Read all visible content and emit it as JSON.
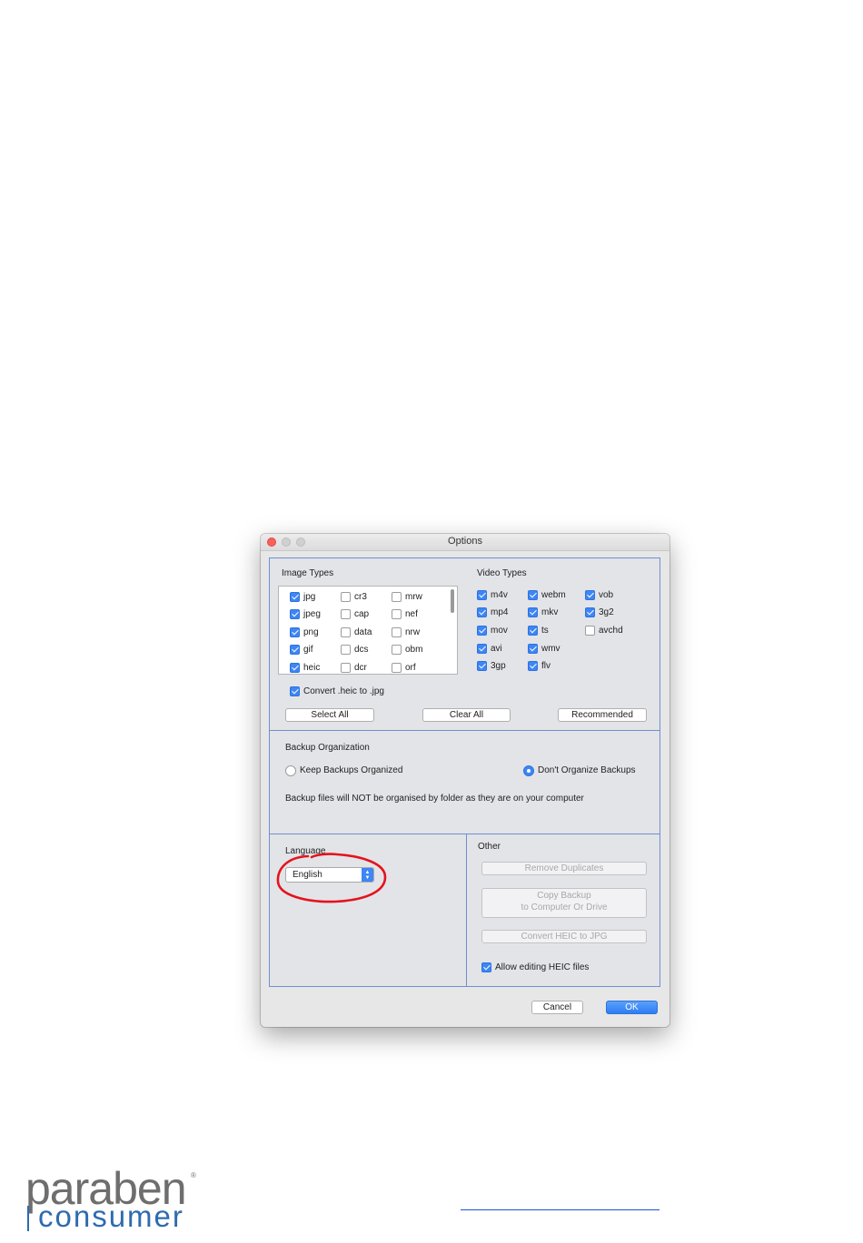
{
  "window": {
    "title": "Options"
  },
  "image_types": {
    "heading": "Image Types",
    "items": [
      {
        "label": "jpg",
        "checked": true
      },
      {
        "label": "jpeg",
        "checked": true
      },
      {
        "label": "png",
        "checked": true
      },
      {
        "label": "gif",
        "checked": true
      },
      {
        "label": "heic",
        "checked": true
      },
      {
        "label": "cr3",
        "checked": false
      },
      {
        "label": "cap",
        "checked": false
      },
      {
        "label": "data",
        "checked": false
      },
      {
        "label": "dcs",
        "checked": false
      },
      {
        "label": "dcr",
        "checked": false
      },
      {
        "label": "mrw",
        "checked": false
      },
      {
        "label": "nef",
        "checked": false
      },
      {
        "label": "nrw",
        "checked": false
      },
      {
        "label": "obm",
        "checked": false
      },
      {
        "label": "orf",
        "checked": false
      }
    ],
    "convert_heic_label": "Convert .heic to .jpg",
    "convert_heic_checked": true
  },
  "video_types": {
    "heading": "Video Types",
    "items": [
      {
        "label": "m4v",
        "checked": true
      },
      {
        "label": "mp4",
        "checked": true
      },
      {
        "label": "mov",
        "checked": true
      },
      {
        "label": "avi",
        "checked": true
      },
      {
        "label": "3gp",
        "checked": true
      },
      {
        "label": "webm",
        "checked": true
      },
      {
        "label": "mkv",
        "checked": true
      },
      {
        "label": "ts",
        "checked": true
      },
      {
        "label": "wmv",
        "checked": true
      },
      {
        "label": "flv",
        "checked": true
      },
      {
        "label": "vob",
        "checked": true
      },
      {
        "label": "3g2",
        "checked": true
      },
      {
        "label": "avchd",
        "checked": false
      }
    ]
  },
  "selection_buttons": {
    "select_all": "Select All",
    "clear_all": "Clear All",
    "recommended": "Recommended"
  },
  "backup_organization": {
    "heading": "Backup Organization",
    "keep_organized": "Keep Backups Organized",
    "dont_organize": "Don't Organize Backups",
    "selected": "dont_organize",
    "description": "Backup files will NOT be organised by folder as they are on your computer"
  },
  "language": {
    "heading": "Language",
    "selected": "English"
  },
  "other": {
    "heading": "Other",
    "remove_duplicates": "Remove Duplicates",
    "copy_backup_line1": "Copy Backup",
    "copy_backup_line2": "to Computer Or Drive",
    "convert_heic": "Convert HEIC to JPG",
    "allow_editing_label": "Allow editing HEIC files",
    "allow_editing_checked": true
  },
  "footer": {
    "cancel": "Cancel",
    "ok": "OK"
  },
  "colors": {
    "accent": "#3d86f5",
    "panel_border": "#6f8fcf",
    "annotation": "#e3141d",
    "brand_blue": "#2e6bb0",
    "brand_gray": "#6e6e6e"
  },
  "brand": {
    "line1": "paraben",
    "line2": "consumer",
    "mark": "®"
  }
}
